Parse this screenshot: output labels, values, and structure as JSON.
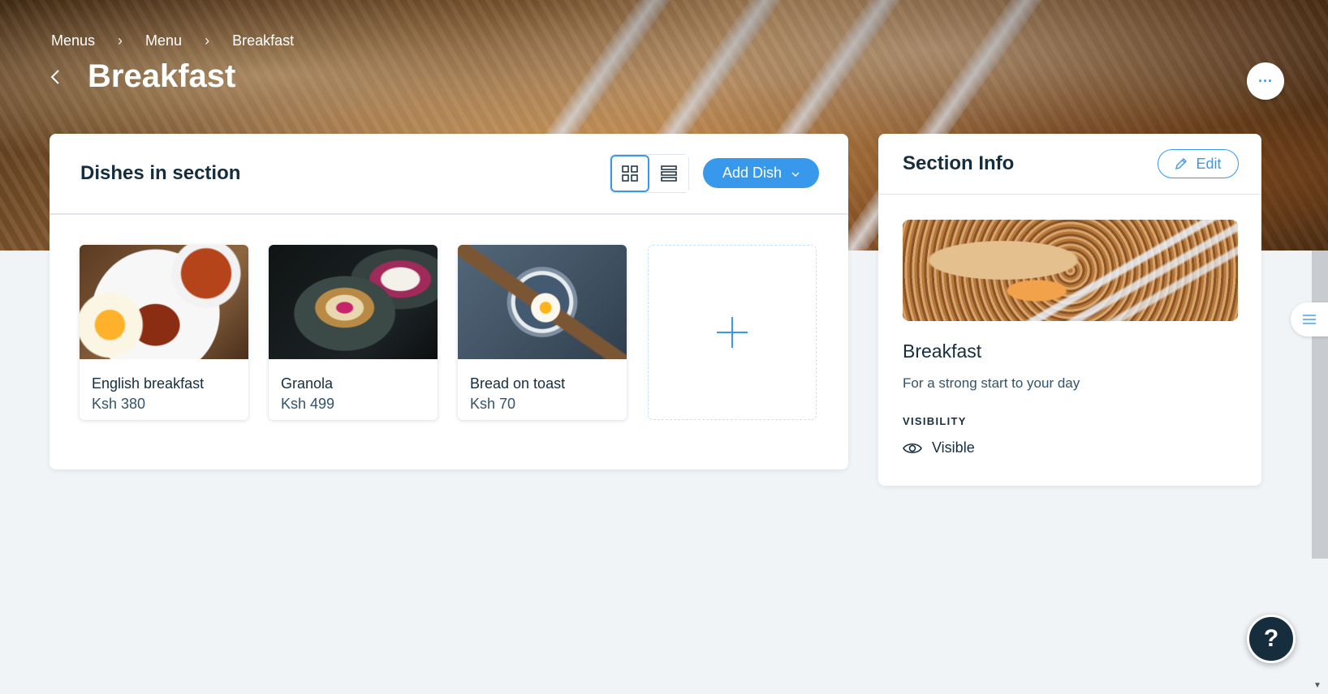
{
  "breadcrumb": [
    {
      "label": "Menus"
    },
    {
      "label": "Menu"
    },
    {
      "label": "Breakfast"
    }
  ],
  "page": {
    "title": "Breakfast"
  },
  "dishes_card": {
    "title": "Dishes in section",
    "add_dish_label": "Add Dish",
    "dishes": [
      {
        "name": "English breakfast",
        "price": "Ksh 380"
      },
      {
        "name": "Granola",
        "price": "Ksh 499"
      },
      {
        "name": "Bread on toast",
        "price": "Ksh 70"
      }
    ]
  },
  "section_info": {
    "title": "Section Info",
    "edit_label": "Edit",
    "name": "Breakfast",
    "description": "For a strong start to your day",
    "visibility_label": "VISIBILITY",
    "visibility_value": "Visible"
  },
  "help": {
    "label": "?"
  },
  "more": {
    "label": "···"
  },
  "colors": {
    "accent": "#3899ec",
    "text_primary": "#162d3d",
    "text_secondary": "#32536a",
    "background": "#f0f4f7"
  }
}
